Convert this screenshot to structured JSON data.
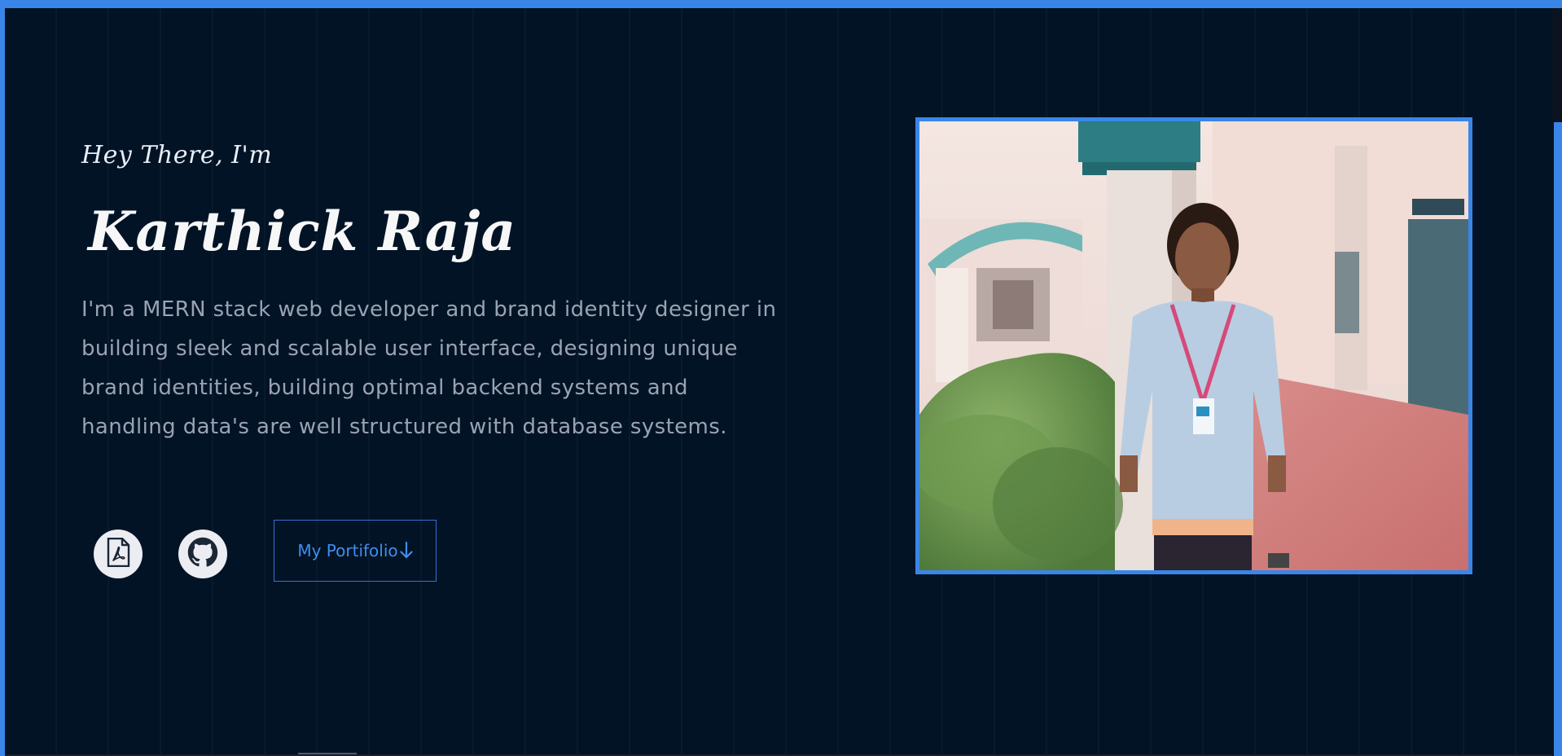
{
  "hero": {
    "greeting": "Hey There, I'm",
    "name": "Karthick Raja",
    "bio": "I'm a MERN stack web developer and brand identity designer in building sleek and scalable user interface, designing unique brand identities, building optimal backend systems and handling data's are well structured with database systems."
  },
  "actions": {
    "resume_icon": "pdf-file-icon",
    "github_icon": "github-icon",
    "portfolio_label": "My Portifolio",
    "portfolio_icon": "arrow-down-icon"
  },
  "photo": {
    "subject": "profile-photo"
  },
  "colors": {
    "accent": "#3a86e8",
    "background": "#011325",
    "button_text": "#3f8ef0",
    "bio_text": "#9aa3b3"
  }
}
